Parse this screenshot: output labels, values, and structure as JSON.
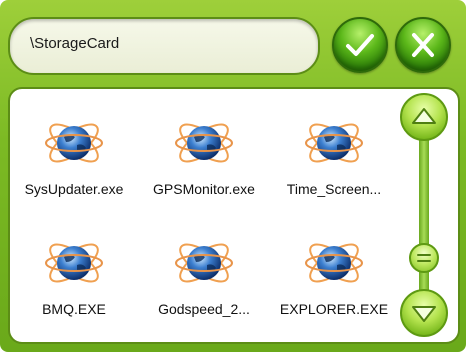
{
  "path_bar": {
    "value": "\\StorageCard"
  },
  "actions": {
    "ok_icon": "checkmark-icon",
    "close_icon": "close-icon"
  },
  "files": [
    {
      "name": "SysUpdater.exe",
      "icon": "globe-atom-icon"
    },
    {
      "name": "GPSMonitor.exe",
      "icon": "globe-atom-icon"
    },
    {
      "name": "Time_Screen...",
      "icon": "globe-atom-icon"
    },
    {
      "name": "BMQ.EXE",
      "icon": "globe-atom-icon"
    },
    {
      "name": "Godspeed_2...",
      "icon": "globe-atom-icon"
    },
    {
      "name": "EXPLORER.EXE",
      "icon": "globe-atom-icon"
    }
  ],
  "scrollbar": {
    "up_icon": "triangle-up-icon",
    "down_icon": "triangle-down-icon",
    "thumb_icon": "grip-lines-icon"
  },
  "colors": {
    "frame_green": "#7cba24",
    "button_green": "#2c7d08",
    "scroll_green": "#b4e34e"
  }
}
